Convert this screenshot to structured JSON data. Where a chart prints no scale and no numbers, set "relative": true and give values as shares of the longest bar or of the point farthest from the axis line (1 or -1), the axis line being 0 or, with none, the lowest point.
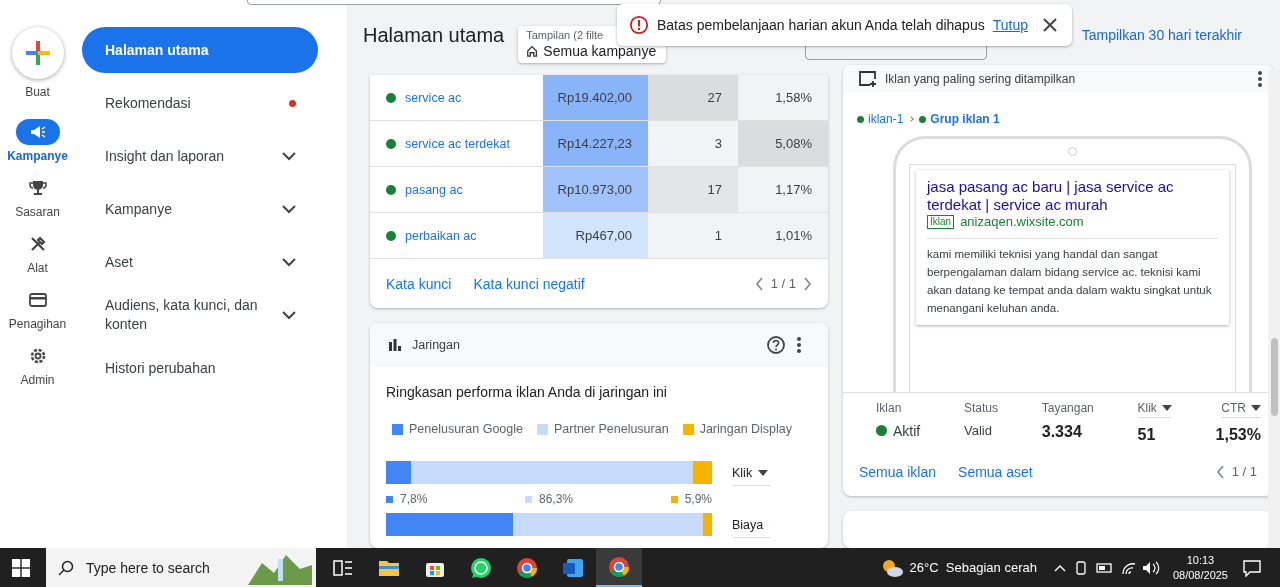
{
  "rail": [
    {
      "label": "Buat",
      "kind": "create",
      "selected": false
    },
    {
      "label": "Kampanye",
      "kind": "campaign",
      "selected": true
    },
    {
      "label": "Sasaran",
      "kind": "goals",
      "selected": false
    },
    {
      "label": "Alat",
      "kind": "tools",
      "selected": false
    },
    {
      "label": "Penagihan",
      "kind": "billing",
      "selected": false
    },
    {
      "label": "Admin",
      "kind": "admin",
      "selected": false
    }
  ],
  "sidebar": {
    "items": [
      {
        "label": "Halaman utama",
        "selected": true,
        "expandable": false,
        "alert": false
      },
      {
        "label": "Rekomendasi",
        "selected": false,
        "expandable": false,
        "alert": true
      },
      {
        "label": "Insight dan laporan",
        "selected": false,
        "expandable": true,
        "alert": false
      },
      {
        "label": "Kampanye",
        "selected": false,
        "expandable": true,
        "alert": false
      },
      {
        "label": "Aset",
        "selected": false,
        "expandable": true,
        "alert": false
      },
      {
        "label": "Audiens, kata kunci, dan konten",
        "selected": false,
        "expandable": true,
        "alert": false
      },
      {
        "label": "Histori perubahan",
        "selected": false,
        "expandable": false,
        "alert": false
      }
    ]
  },
  "header": {
    "title": "Halaman utama",
    "view_label": "Tampilan (2 filte",
    "view_value": "Semua kampanye",
    "date_link": "Tampilkan 30 hari terakhir"
  },
  "toast": {
    "message": "Batas pembelanjaan harian akun Anda telah dihapus",
    "action": "Tutup"
  },
  "keywords": {
    "rows": [
      {
        "keyword": "service ac",
        "color": "#188038",
        "cells": [
          {
            "text": "Rp19.402,00",
            "color": "#8ab4f8"
          },
          {
            "text": "27",
            "color": "#dadce0"
          },
          {
            "text": "1,58%",
            "color": "#f1f3f4"
          }
        ]
      },
      {
        "keyword": "service ac terdekat",
        "color": "#188038",
        "cells": [
          {
            "text": "Rp14.227,23",
            "color": "#8ab4f8"
          },
          {
            "text": "3",
            "color": "#f1f3f4"
          },
          {
            "text": "5,08%",
            "color": "#dadce0"
          }
        ]
      },
      {
        "keyword": "pasang ac",
        "color": "#188038",
        "cells": [
          {
            "text": "Rp10.973,00",
            "color": "#a1c2fa"
          },
          {
            "text": "17",
            "color": "#e4e5e7"
          },
          {
            "text": "1,17%",
            "color": "#f1f3f4"
          }
        ]
      },
      {
        "keyword": "perbaikan ac",
        "color": "#188038",
        "cells": [
          {
            "text": "Rp467,00",
            "color": "#d2e3fc"
          },
          {
            "text": "1",
            "color": "#f1f3f4"
          },
          {
            "text": "1,01%",
            "color": "#f1f3f4"
          }
        ]
      }
    ],
    "links": [
      "Kata kunci",
      "Kata kunci negatif"
    ],
    "pager": "1 / 1"
  },
  "network": {
    "title": "Jaringan",
    "subtitle": "Ringkasan performa iklan Anda di jaringan ini",
    "rows": [
      {
        "labels": [
          "7,8%",
          "86,3%",
          "5,9%"
        ]
      },
      {
        "labels": []
      }
    ],
    "chart_data": {
      "type": "bar",
      "orientation": "horizontal",
      "stacked": true,
      "relative": true,
      "categories": [
        "Klik",
        "Biaya"
      ],
      "series": [
        {
          "name": "Penelusuran Google",
          "color": "#4285f4",
          "values": [
            0.078,
            0.39
          ]
        },
        {
          "name": "Partner Penelusuran",
          "color": "#c6dafc",
          "values": [
            0.863,
            0.582
          ]
        },
        {
          "name": "Jaringan Display",
          "color": "#f4b400",
          "values": [
            0.059,
            0.028
          ]
        }
      ]
    }
  },
  "ad": {
    "title": "Iklan yang paling sering ditampilkan",
    "breadcrumb": [
      {
        "label": "iklan-1",
        "color": "#188038"
      },
      {
        "label": "Grup iklan 1",
        "color": "#188038"
      }
    ],
    "headline": "jasa pasang ac baru | jasa service ac terdekat | service ac murah",
    "badge": "Iklan",
    "url": "anizaqen.wixsite.com",
    "description": "kami memiliki teknisi yang handal dan sangat berpengalaman dalam bidang service ac. teknisi kami akan datang ke tempat anda dalam waktu singkat untuk menangani keluhan anda.",
    "stats": [
      {
        "label": "Iklan",
        "value": "Aktif",
        "kind": "status",
        "sortable": false,
        "color": "#188038"
      },
      {
        "label": "Status",
        "value": "Valid",
        "kind": "plain",
        "sortable": false
      },
      {
        "label": "Tayangan",
        "value": "3.334",
        "kind": "number",
        "sortable": false
      },
      {
        "label": "Klik",
        "value": "51",
        "kind": "number",
        "sortable": true
      },
      {
        "label": "CTR",
        "value": "1,53%",
        "kind": "number",
        "sortable": true
      }
    ],
    "links": [
      "Semua iklan",
      "Semua aset"
    ],
    "pager": "1 / 1"
  },
  "taskbar": {
    "search_placeholder": "Type here to search",
    "apps": [
      {
        "kind": "task-view",
        "selected": false
      },
      {
        "kind": "folder",
        "selected": false
      },
      {
        "kind": "store",
        "selected": false
      },
      {
        "kind": "whatsapp",
        "selected": false
      },
      {
        "kind": "chrome",
        "selected": false
      },
      {
        "kind": "word",
        "selected": false
      },
      {
        "kind": "chrome",
        "selected": true
      }
    ],
    "weather": "26°C  Sebagian cerah",
    "time": "10:13",
    "date": "08/08/2025"
  }
}
